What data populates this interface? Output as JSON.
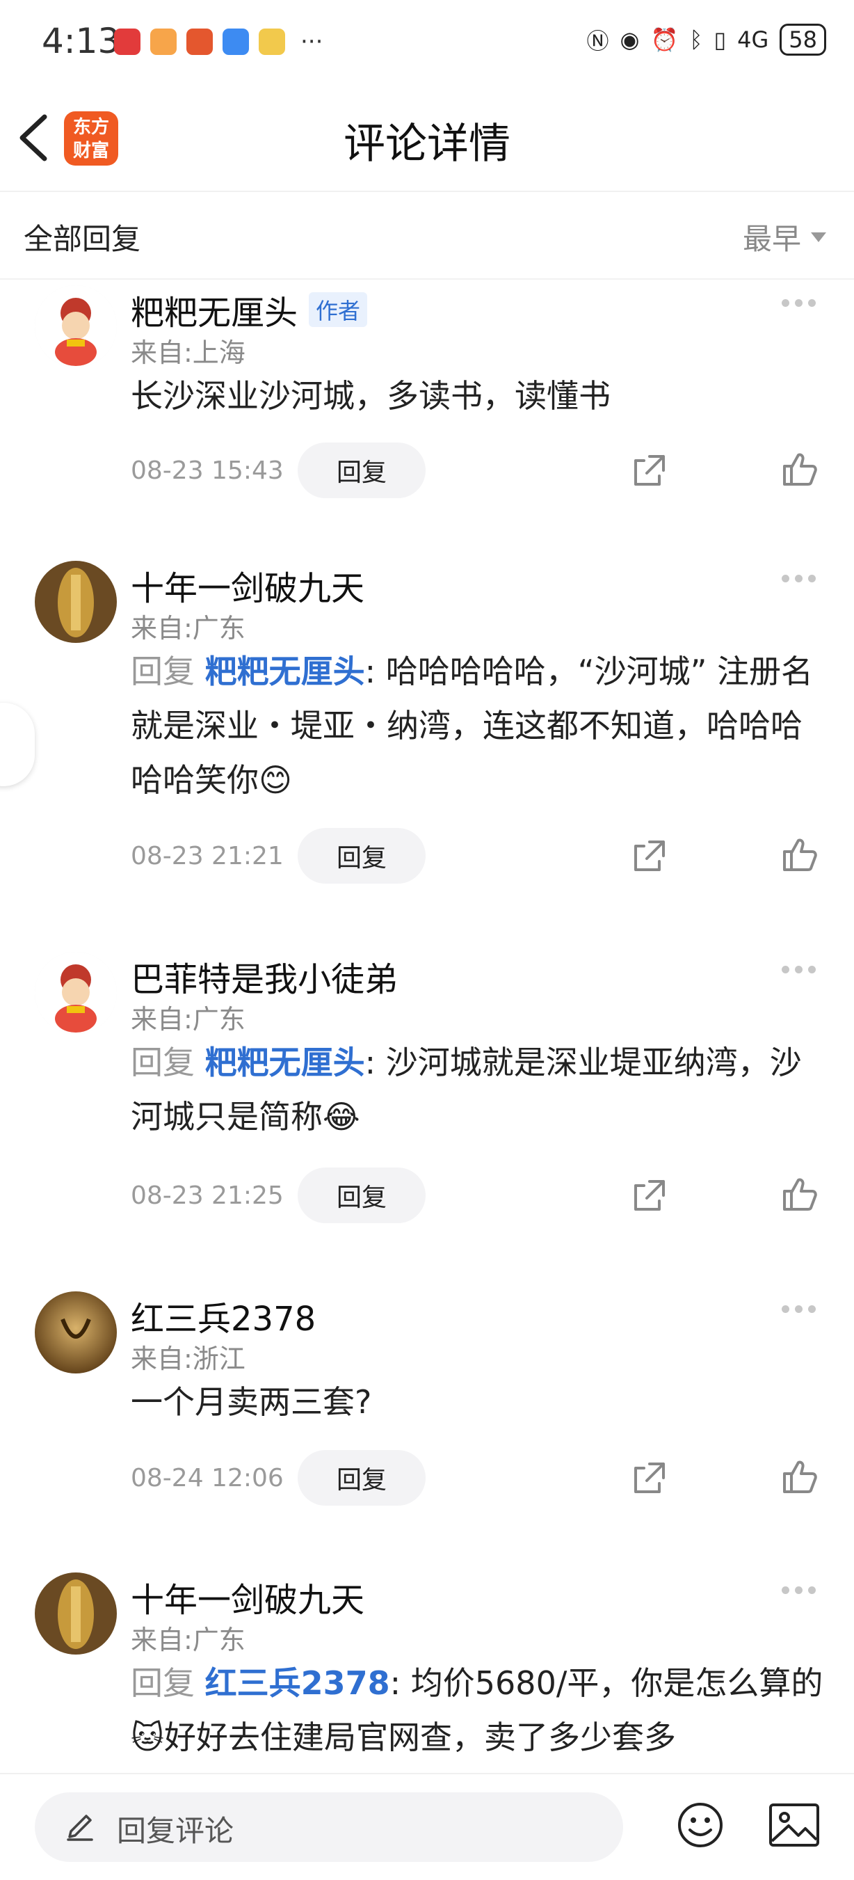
{
  "status_bar": {
    "time": "4:13",
    "more": "···",
    "signal": "4G",
    "battery": "58"
  },
  "header": {
    "title": "评论详情",
    "brand": "东方\n财富"
  },
  "filter": {
    "label": "全部回复",
    "sort": "最早"
  },
  "comments": [
    {
      "name": "粑粑无厘头",
      "tag": "作者",
      "location": "来自:上海",
      "text": "长沙深业沙河城，多读书，读懂书",
      "time": "08-23 15:43",
      "reply_label": "回复"
    },
    {
      "name": "十年一剑破九天",
      "location": "来自:广东",
      "reply_prefix": "回复 ",
      "reply_to": "粑粑无厘头",
      "text": ": 哈哈哈哈哈，“沙河城” 注册名就是深业・堤亚・纳湾，连这都不知道，哈哈哈哈哈笑你😊",
      "time": "08-23 21:21",
      "reply_label": "回复"
    },
    {
      "name": "巴菲特是我小徒弟",
      "location": "来自:广东",
      "reply_prefix": "回复 ",
      "reply_to": "粑粑无厘头",
      "text": ": 沙河城就是深业堤亚纳湾，沙河城只是简称😂",
      "time": "08-23 21:25",
      "reply_label": "回复"
    },
    {
      "name": "红三兵2378",
      "location": "来自:浙江",
      "text": "一个月卖两三套?",
      "time": "08-24 12:06",
      "reply_label": "回复"
    },
    {
      "name": "十年一剑破九天",
      "location": "来自:广东",
      "reply_prefix": "回复 ",
      "reply_to": "红三兵2378",
      "text": ": 均价5680/平，你是怎么算的🐱好好去住建局官网查，卖了多少套多",
      "time": "",
      "reply_label": "回复"
    }
  ],
  "bottom_bar": {
    "placeholder": "回复评论"
  },
  "colors": {
    "brand": "#f05a22",
    "link": "#2f6fd1"
  }
}
